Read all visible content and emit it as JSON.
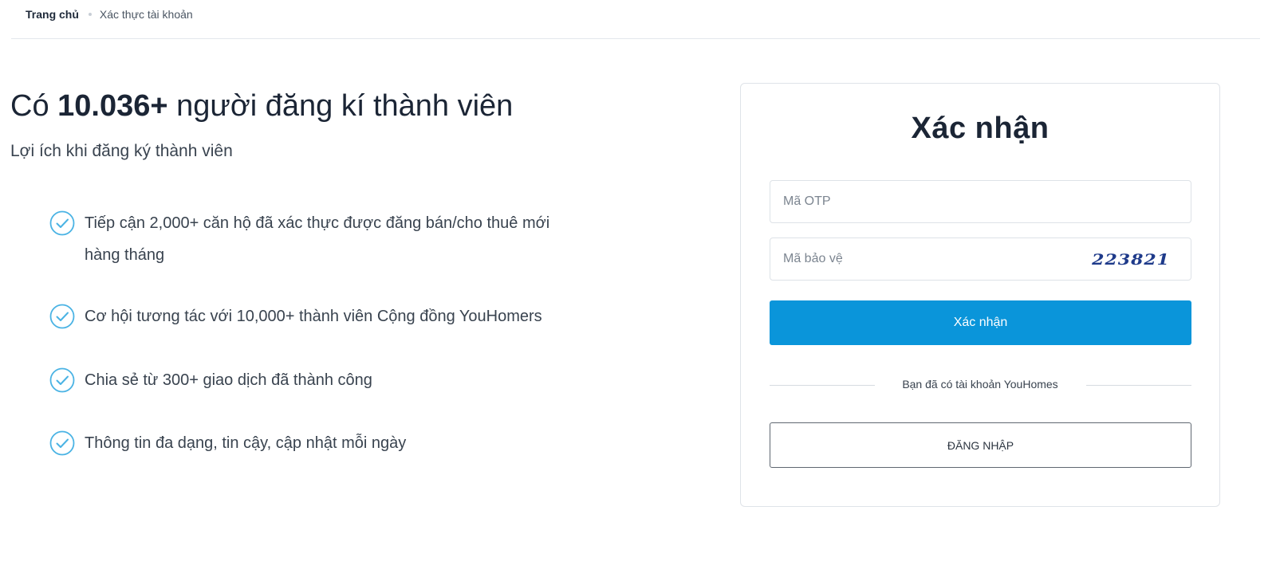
{
  "breadcrumb": {
    "home": "Trang chủ",
    "current": "Xác thực tài khoản"
  },
  "hero": {
    "title_prefix": "Có",
    "member_count": "10.036+",
    "title_suffix": "người đăng kí thành viên",
    "subtitle": "Lợi ích khi đăng ký thành viên"
  },
  "benefits": [
    {
      "line1": "Tiếp cận 2,000+ căn hộ đã xác thực được đăng bán/cho thuê mới",
      "line2": "hàng tháng",
      "icon": "check-circle-icon"
    },
    {
      "line1": "Cơ hội tương tác với 10,000+ thành viên Cộng đồng YouHomers",
      "icon": "check-circle-icon"
    },
    {
      "line1": "Chia sẻ từ 300+ giao dịch đã thành công",
      "icon": "check-circle-icon"
    },
    {
      "line1": "Thông tin đa dạng, tin cậy, cập nhật mỗi ngày",
      "icon": "check-circle-icon"
    }
  ],
  "form": {
    "title": "Xác nhận",
    "otp_placeholder": "Mã OTP",
    "otp_value": "",
    "security_placeholder": "Mã bảo vệ",
    "security_value": "",
    "captcha_code": "223821",
    "submit_label": "Xác nhận",
    "divider_text": "Bạn đã có tài khoản YouHomes",
    "login_label": "ĐĂNG NHẬP"
  },
  "colors": {
    "primary": "#0a95da",
    "check_icon": "#4ab3e4",
    "text_dark": "#1b2535",
    "captcha": "#1e3a8a"
  }
}
